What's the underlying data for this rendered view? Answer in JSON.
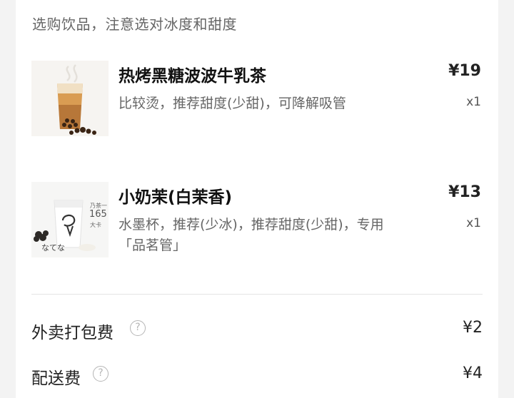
{
  "notice": "选购饮品，注意选对冰度和甜度",
  "items": [
    {
      "name": "热烤黑糖波波牛乳茶",
      "desc": "比较烫，推荐甜度(少甜)，可降解吸管",
      "price": "¥19",
      "qty": "x1",
      "thumb_icon": "brown-sugar-boba-milk-tea-image"
    },
    {
      "name": "小奶茉(白茉香)",
      "desc": "水墨杯，推荐(少冰)，推荐甜度(少甜)，专用「品茗管」",
      "price": "¥13",
      "qty": "x1",
      "thumb_icon": "jasmine-milk-tea-image",
      "thumb_text": {
        "top": "乃茶一",
        "big": "165",
        "unit": "大卡"
      }
    }
  ],
  "fees": [
    {
      "label": "外卖打包费",
      "value": "¥2",
      "icon": "question-circle-icon"
    },
    {
      "label": "配送费",
      "value": "¥4",
      "icon": "question-circle-icon"
    }
  ],
  "help_glyph": "?",
  "colors": {
    "background": "#f3f3f3",
    "card": "#ffffff",
    "primary_text": "#111111",
    "secondary_text": "#666666",
    "divider": "#e5e5e5"
  }
}
